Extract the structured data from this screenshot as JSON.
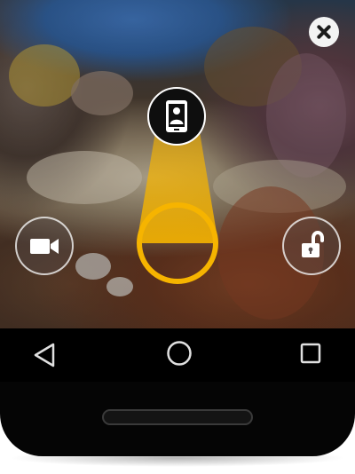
{
  "app": {
    "accent_color": "#f6b400"
  },
  "icons": {
    "close": "close-icon",
    "target": "phone-contact-icon",
    "camera": "video-camera-icon",
    "unlock": "unlocked-padlock-icon",
    "back": "back-triangle-icon",
    "home": "home-circle-icon",
    "recents": "recents-square-icon"
  },
  "navigation_bar": {
    "items": [
      "back",
      "home",
      "recents"
    ]
  }
}
